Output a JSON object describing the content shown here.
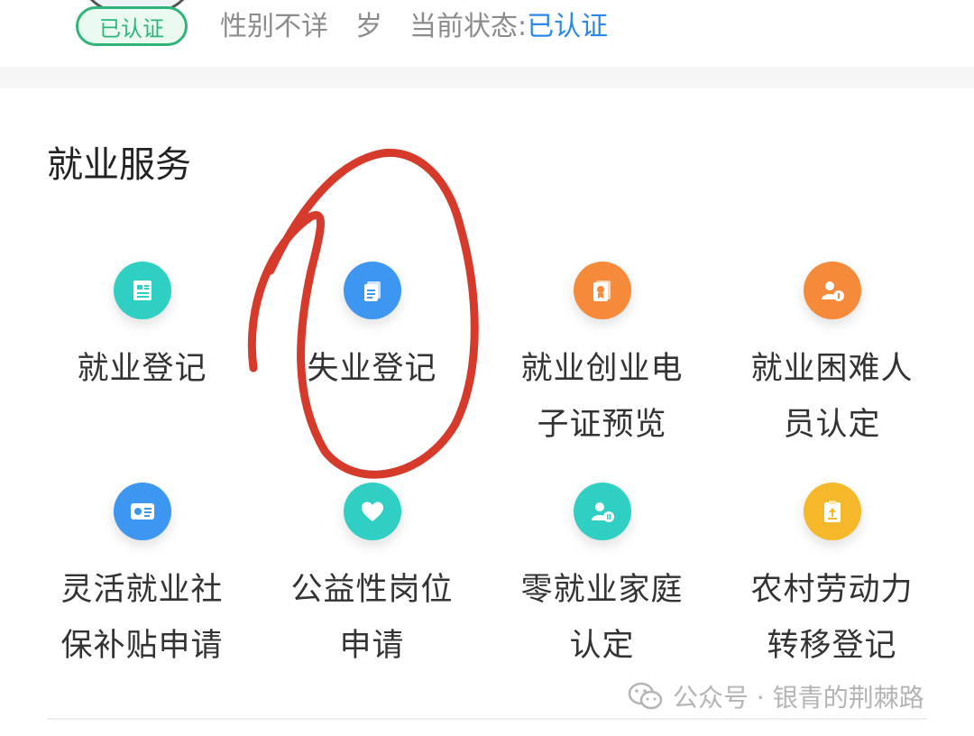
{
  "profile": {
    "badge": "已认证",
    "gender": "性别不详",
    "age_unit": "岁",
    "status_label": "当前状态:",
    "status_value": "已认证"
  },
  "section": {
    "title": "就业服务"
  },
  "services": [
    {
      "line1": "就业登记",
      "line2": "",
      "icon": "document-icon",
      "color": "#2fd0c3"
    },
    {
      "line1": "失业登记",
      "line2": "",
      "icon": "file-icon",
      "color": "#3d96f0"
    },
    {
      "line1": "就业创业电",
      "line2": "子证预览",
      "icon": "certificate-icon",
      "color": "#f58a3a"
    },
    {
      "line1": "就业困难人",
      "line2": "员认定",
      "icon": "person-info-icon",
      "color": "#f58a3a"
    },
    {
      "line1": "灵活就业社",
      "line2": "保补贴申请",
      "icon": "id-card-icon",
      "color": "#3d96f0"
    },
    {
      "line1": "公益性岗位",
      "line2": "申请",
      "icon": "heart-icon",
      "color": "#2fd0c3"
    },
    {
      "line1": "零就业家庭",
      "line2": "认定",
      "icon": "person-badge-icon",
      "color": "#2fd0c3"
    },
    {
      "line1": "农村劳动力",
      "line2": "转移登记",
      "icon": "clipboard-icon",
      "color": "#f5b82a"
    }
  ],
  "watermark": {
    "text": "公众号 · 银青的荆棘路",
    "icon": "wechat-icon"
  }
}
